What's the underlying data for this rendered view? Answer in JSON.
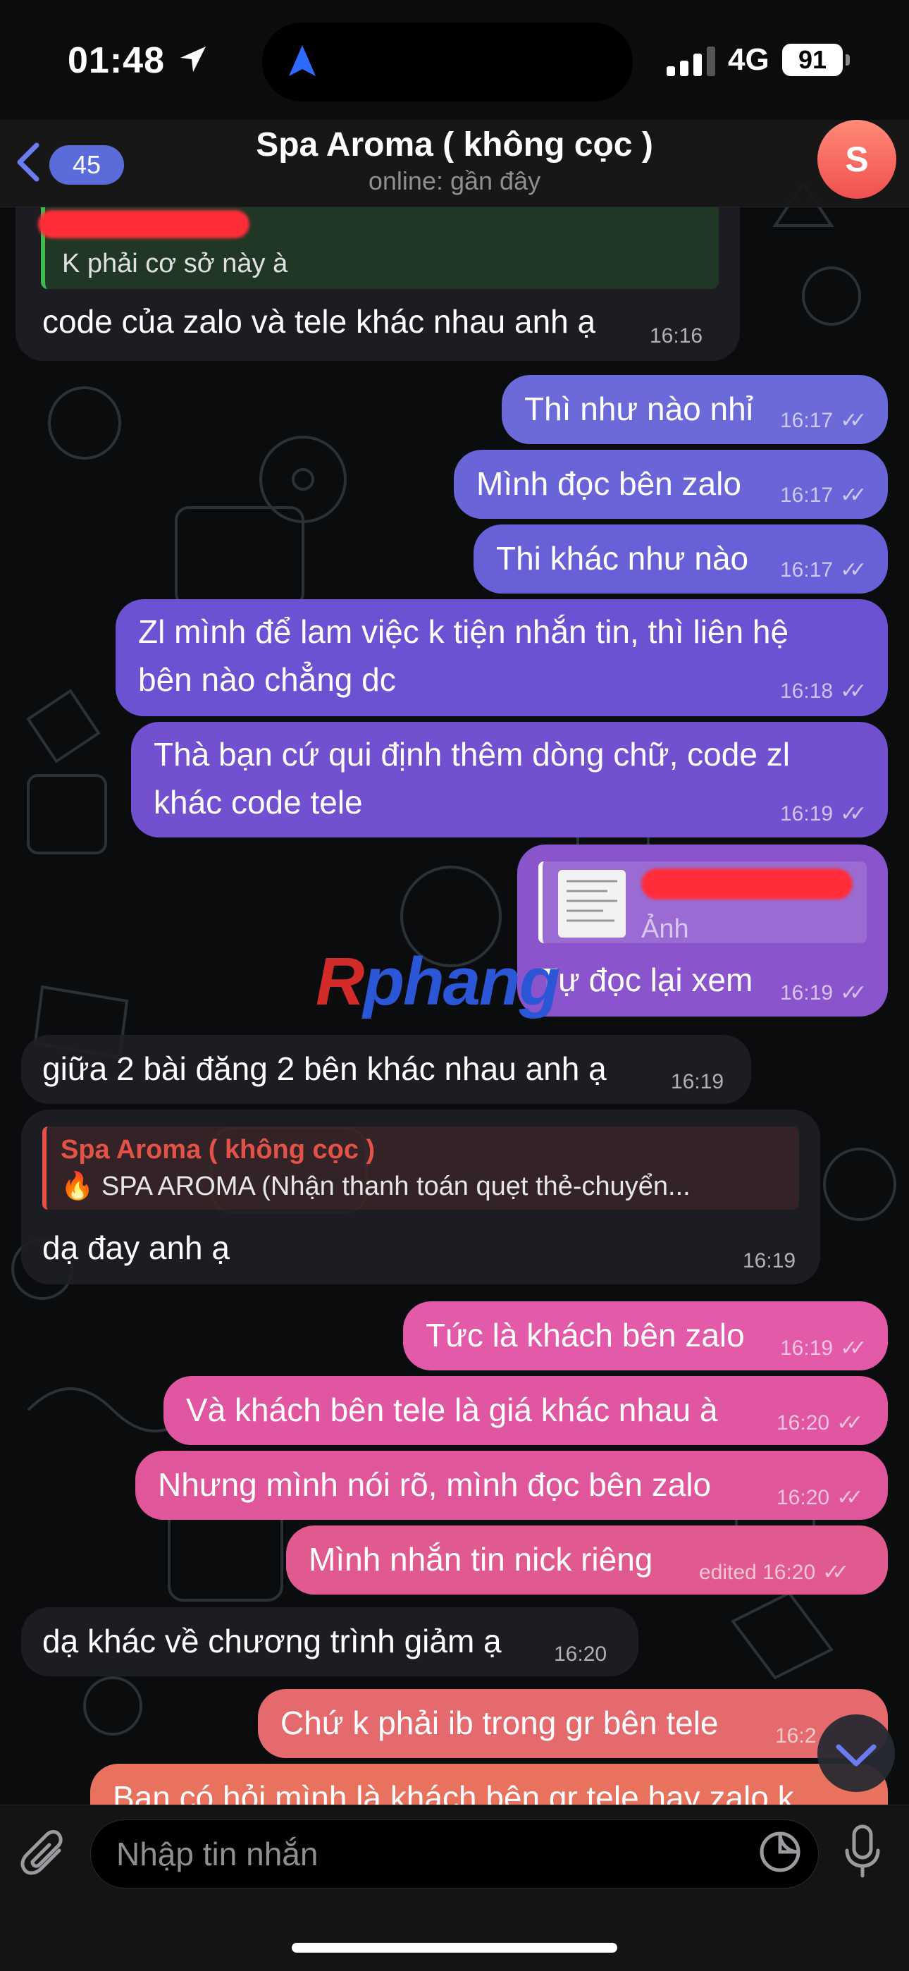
{
  "status_bar": {
    "time": "01:48",
    "network": "4G",
    "battery": "91"
  },
  "header": {
    "back_count": "45",
    "title": "Spa Aroma ( không cọc )",
    "subtitle": "online: gần đây",
    "avatar_letter": "S"
  },
  "messages": [
    {
      "dir": "in",
      "reply_text": "K phải cơ sở này à",
      "text": "code của zalo và tele khác nhau anh ạ",
      "time": "16:16"
    },
    {
      "dir": "out",
      "text": "Thì như nào nhỉ",
      "time": "16:17"
    },
    {
      "dir": "out",
      "text": "Mình đọc bên zalo",
      "time": "16:17"
    },
    {
      "dir": "out",
      "text": "Thi khác như nào",
      "time": "16:17"
    },
    {
      "dir": "out",
      "line1": "Zl mình để lam việc k tiện nhắn tin, thì liên hệ",
      "line2": "bên nào chẳng dc",
      "time": "16:18"
    },
    {
      "dir": "out",
      "line1": "Thà bạn cứ qui định thêm dòng chữ, code zl",
      "line2": "khác code tele",
      "time": "16:19"
    },
    {
      "dir": "out",
      "reply_text": "Ảnh",
      "text": "Tự đọc lại xem",
      "time": "16:19"
    },
    {
      "dir": "in",
      "text": "giữa 2 bài đăng 2 bên khác nhau anh ạ",
      "time": "16:19"
    },
    {
      "dir": "in",
      "reply_name": "Spa Aroma ( không cọc )",
      "reply_text": "🔥 SPA AROMA (Nhận thanh toán quẹt thẻ-chuyển...",
      "text": "dạ đay anh ạ",
      "time": "16:19"
    },
    {
      "dir": "out",
      "text": "Tức là khách bên zalo",
      "time": "16:19"
    },
    {
      "dir": "out",
      "text": "Và khách bên tele là giá khác nhau à",
      "time": "16:20"
    },
    {
      "dir": "out",
      "text": "Nhưng mình nói rõ, mình đọc bên zalo",
      "time": "16:20"
    },
    {
      "dir": "out",
      "text": "Mình nhắn tin nick riêng",
      "time": "edited 16:20"
    },
    {
      "dir": "in",
      "text": "dạ khác về chương trình giảm ạ",
      "time": "16:20"
    },
    {
      "dir": "out",
      "text": "Chứ k phải ib trong gr bên tele",
      "time": "16:2"
    },
    {
      "dir": "out",
      "text": "Bạn có hỏi mình là khách bên gr tele hay zalo k"
    }
  ],
  "watermark": {
    "r": "R",
    "rest": "phang"
  },
  "composer": {
    "placeholder": "Nhập tin nhắn"
  },
  "icons": {
    "back": "chevron-left-icon",
    "location": "location-arrow-icon",
    "attach": "paperclip-icon",
    "sticker": "sticker-icon",
    "mic": "microphone-icon",
    "scroll": "chevron-down-icon",
    "read": "double-check-icon"
  },
  "colors": {
    "badge": "#5b6bd9",
    "avatar": "#f0504f",
    "bubble_blue": "#6468dc",
    "bubble_purple": "#7a4fcf",
    "bubble_pink": "#e0559b",
    "bubble_coral": "#e8685f",
    "reply_green": "#2e7d32",
    "reply_red": "#e35247"
  }
}
